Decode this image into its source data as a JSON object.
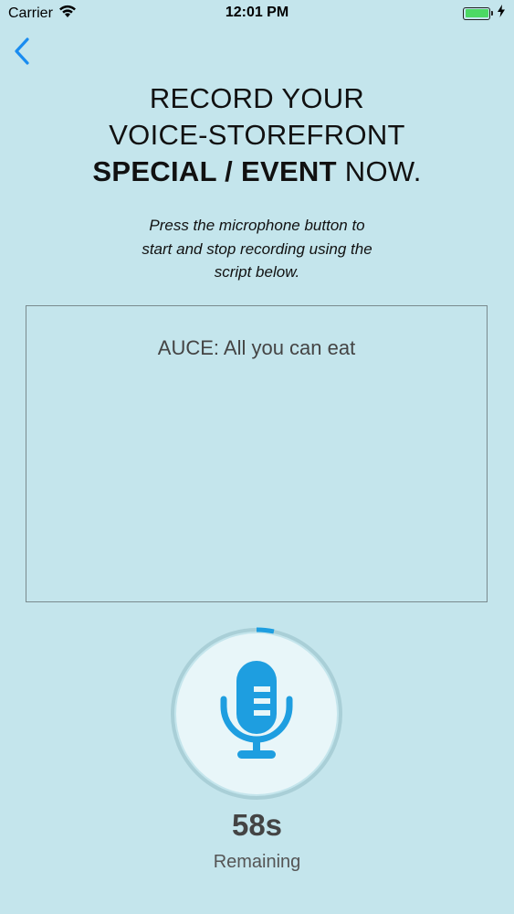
{
  "status_bar": {
    "carrier": "Carrier",
    "time": "12:01 PM",
    "battery_level": 1.0,
    "charging": true,
    "icons": [
      "wifi-icon",
      "battery-icon",
      "charging-bolt-icon"
    ]
  },
  "nav": {
    "back_icon": "chevron-left-icon",
    "accent_color": "#1a8cf0"
  },
  "headline": {
    "line1": "RECORD YOUR",
    "line2": "VOICE-STOREFRONT",
    "line3_bold": "SPECIAL / EVENT",
    "line3_rest": " NOW."
  },
  "instructions": {
    "line1": "Press the microphone button to",
    "line2": "start and stop recording using the",
    "line3": "script below."
  },
  "script": {
    "text": "AUCE: All you can eat"
  },
  "recorder": {
    "mic_icon": "microphone-icon",
    "mic_color": "#1e9ee0",
    "progress_fraction": 0.033,
    "seconds_remaining": "58s",
    "remaining_label": "Remaining"
  }
}
